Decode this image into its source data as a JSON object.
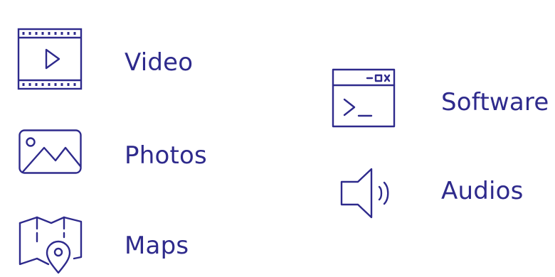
{
  "colors": {
    "accent": "#2e2a8c",
    "background": "#ffffff"
  },
  "items": [
    {
      "label": "Video",
      "icon": "video-film-icon"
    },
    {
      "label": "Photos",
      "icon": "photo-icon"
    },
    {
      "label": "Maps",
      "icon": "map-pin-icon"
    },
    {
      "label": "Software",
      "icon": "terminal-window-icon"
    },
    {
      "label": "Audios",
      "icon": "speaker-icon"
    }
  ]
}
